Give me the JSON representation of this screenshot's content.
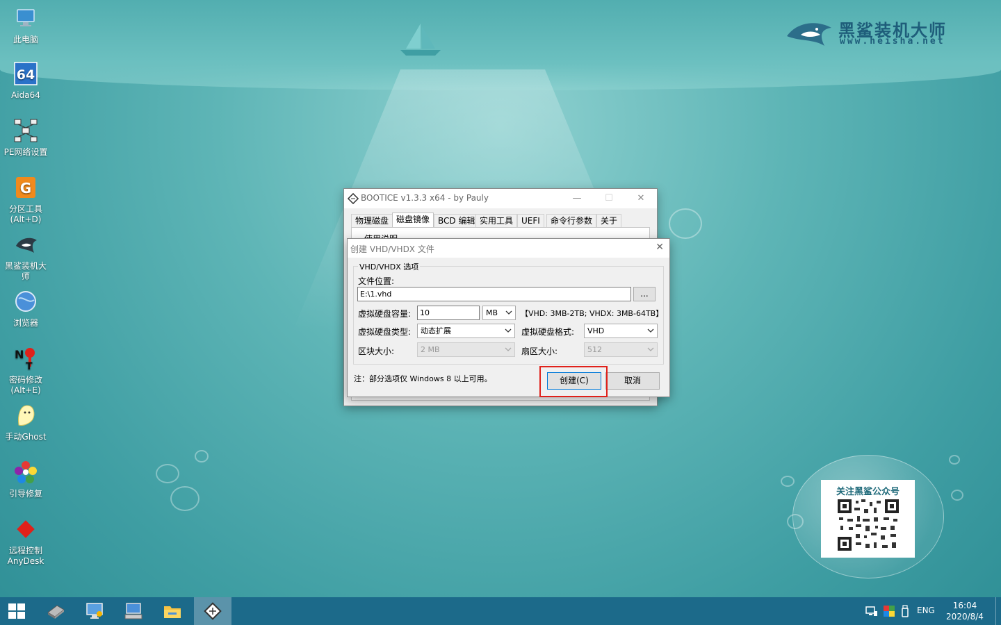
{
  "desktop": {
    "icons": [
      {
        "label": "此电脑",
        "icon": "computer-icon"
      },
      {
        "label": "Aida64",
        "icon": "aida64-icon"
      },
      {
        "label": "PE网络设置",
        "icon": "network-icon"
      },
      {
        "label": "分区工具\n(Alt+D)",
        "icon": "partition-tool-icon"
      },
      {
        "label": "黑鲨装机大师",
        "icon": "shark-icon"
      },
      {
        "label": "浏览器",
        "icon": "browser-icon"
      },
      {
        "label": "密码修改\n(Alt+E)",
        "icon": "password-icon"
      },
      {
        "label": "手动Ghost",
        "icon": "ghost-icon"
      },
      {
        "label": "引导修复",
        "icon": "boot-repair-icon"
      },
      {
        "label": "远程控制\nAnyDesk",
        "icon": "anydesk-icon"
      }
    ],
    "logo": {
      "name": "黑鲨装机大师",
      "url": "www.heisha.net"
    },
    "qr": {
      "title": "关注黑鲨公众号"
    }
  },
  "bootice": {
    "title": "BOOTICE v1.3.3 x64 - by Pauly",
    "tabs": [
      "物理磁盘",
      "磁盘镜像",
      "BCD 编辑",
      "实用工具",
      "UEFI",
      "命令行参数",
      "关于"
    ],
    "active_tab": "磁盘镜像",
    "panel_legend": "使用说明"
  },
  "vhd_dialog": {
    "title": "创建 VHD/VHDX 文件",
    "group_label": "VHD/VHDX 选项",
    "file_location_label": "文件位置:",
    "file_path": "E:\\1.vhd",
    "browse_label": "...",
    "capacity_label": "虚拟硬盘容量:",
    "capacity_value": "10",
    "capacity_unit": "MB",
    "capacity_hint": "【VHD: 3MB-2TB; VHDX: 3MB-64TB】",
    "disk_type_label": "虚拟硬盘类型:",
    "disk_type_value": "动态扩展",
    "disk_format_label": "虚拟硬盘格式:",
    "disk_format_value": "VHD",
    "block_size_label": "区块大小:",
    "block_size_value": "2 MB",
    "sector_size_label": "扇区大小:",
    "sector_size_value": "512",
    "note": "注：部分选项仅 Windows 8 以上可用。",
    "create_label": "创建(C)",
    "cancel_label": "取消",
    "highlight_color": "#e0211a"
  },
  "taskbar": {
    "language": "ENG",
    "time": "16:04",
    "date": "2020/8/4",
    "color": "#1c6a8a"
  }
}
